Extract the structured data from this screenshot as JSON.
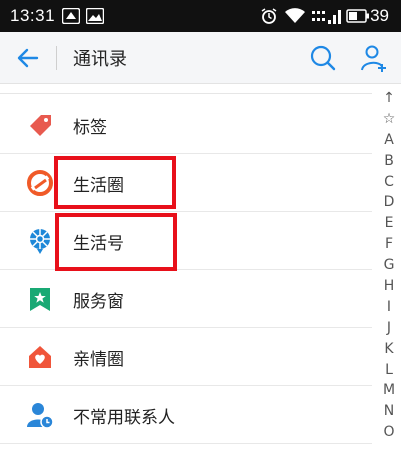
{
  "status_bar": {
    "time": "13:31",
    "battery_level": "39",
    "icons": [
      "alipay-notification-icon",
      "image-notification-icon",
      "alarm-icon",
      "wifi-icon",
      "signal-icon",
      "battery-icon"
    ]
  },
  "app_bar": {
    "title": "通讯录",
    "back_icon": "back-arrow-icon",
    "search_icon": "search-icon",
    "add_contact_icon": "add-contact-icon"
  },
  "list": {
    "items": [
      {
        "label": "标签",
        "icon": "tag-icon",
        "color": "#e85a4f"
      },
      {
        "label": "生活圈",
        "icon": "life-circle-icon",
        "color": "#f05a28"
      },
      {
        "label": "生活号",
        "icon": "life-account-icon",
        "color": "#1e88d8"
      },
      {
        "label": "服务窗",
        "icon": "service-window-icon",
        "color": "#19a974"
      },
      {
        "label": "亲情圈",
        "icon": "family-circle-icon",
        "color": "#f0553a"
      },
      {
        "label": "不常用联系人",
        "icon": "inactive-contacts-icon",
        "color": "#2a86d8"
      }
    ]
  },
  "index_bar": {
    "letters": [
      "↑",
      "☆",
      "A",
      "B",
      "C",
      "D",
      "E",
      "F",
      "G",
      "H",
      "I",
      "J",
      "K",
      "L",
      "M",
      "N",
      "O"
    ]
  },
  "colors": {
    "accent": "#1e88e5",
    "highlight": "#e8101a",
    "status_bar_bg": "#111111"
  }
}
